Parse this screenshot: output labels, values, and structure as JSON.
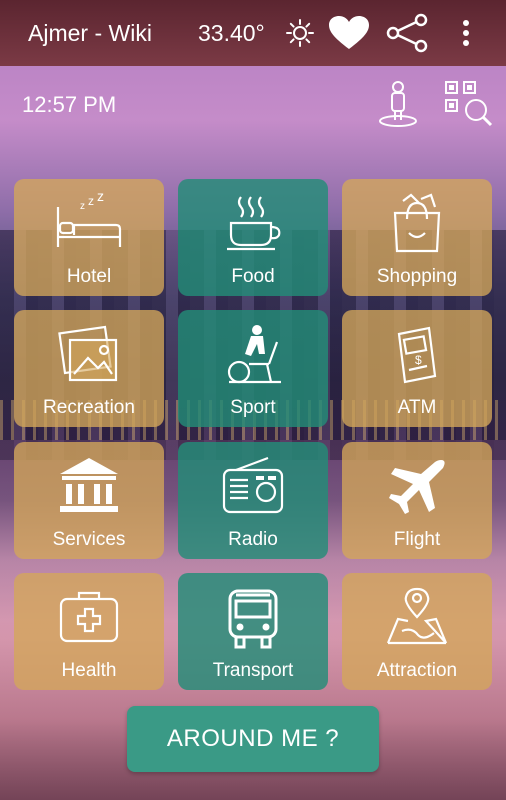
{
  "header": {
    "title": "Ajmer - Wiki",
    "temperature": "33.40°"
  },
  "status": {
    "time": "12:57 PM"
  },
  "tiles": [
    {
      "label": "Hotel",
      "icon": "bed-icon",
      "color": "gold"
    },
    {
      "label": "Food",
      "icon": "coffee-cup-icon",
      "color": "teal"
    },
    {
      "label": "Shopping",
      "icon": "shopping-bag-icon",
      "color": "gold"
    },
    {
      "label": "Recreation",
      "icon": "picture-icon",
      "color": "gold"
    },
    {
      "label": "Sport",
      "icon": "exercise-bike-icon",
      "color": "teal"
    },
    {
      "label": "ATM",
      "icon": "atm-machine-icon",
      "color": "gold"
    },
    {
      "label": "Services",
      "icon": "bank-building-icon",
      "color": "gold"
    },
    {
      "label": "Radio",
      "icon": "radio-icon",
      "color": "teal"
    },
    {
      "label": "Flight",
      "icon": "airplane-icon",
      "color": "gold"
    },
    {
      "label": "Health",
      "icon": "first-aid-kit-icon",
      "color": "gold"
    },
    {
      "label": "Transport",
      "icon": "bus-icon",
      "color": "teal"
    },
    {
      "label": "Attraction",
      "icon": "map-pin-icon",
      "color": "gold"
    }
  ],
  "around_button": {
    "label": "AROUND ME ?"
  },
  "colors": {
    "header": "#6b2f3a",
    "tile_gold": "#d4a65a",
    "tile_teal": "#238c78",
    "button": "#3a9a86"
  }
}
